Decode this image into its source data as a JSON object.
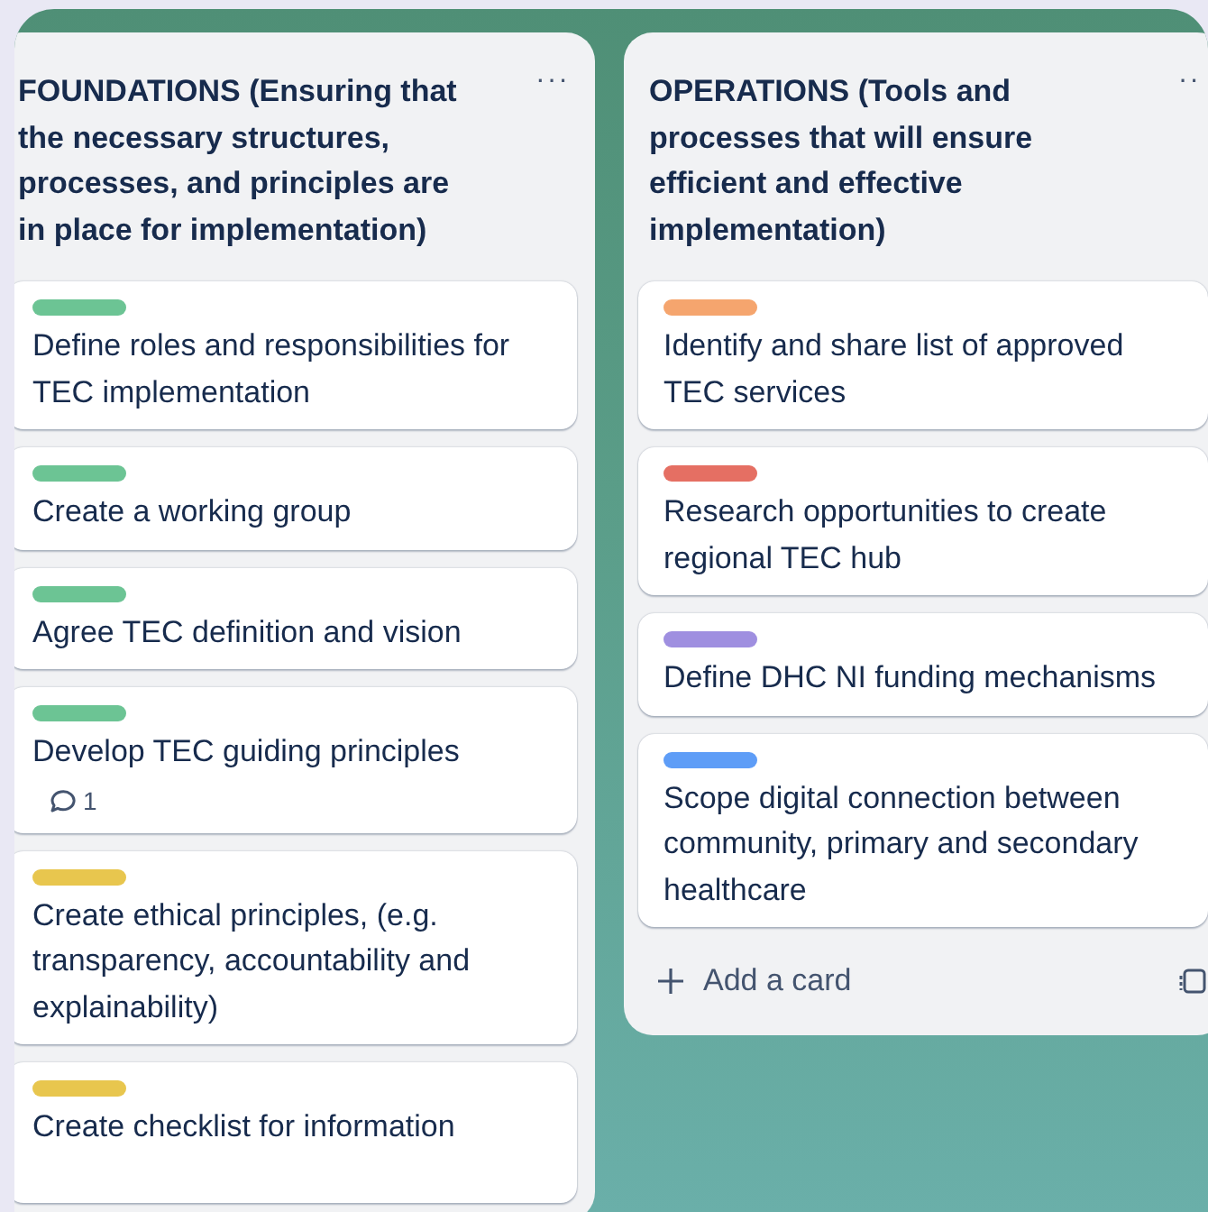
{
  "lists": [
    {
      "title": "FOUNDATIONS (Ensuring that the necessary structures, processes, and principles are in place for implementation)",
      "menu": "···",
      "cards": [
        {
          "color": "#6cc494",
          "text": "Define roles and responsibilities for TEC implementation"
        },
        {
          "color": "#6cc494",
          "text": "Create a working group"
        },
        {
          "color": "#6cc494",
          "text": "Agree TEC definition and vision"
        },
        {
          "color": "#6cc494",
          "text": "Develop TEC guiding principles",
          "comments": "1"
        },
        {
          "color": "#e8c64e",
          "text": "Create ethical principles, (e.g. transparency, accountability and explainability)"
        },
        {
          "color": "#e8c64e",
          "text": "Create checklist for information"
        }
      ]
    },
    {
      "title": "OPERATIONS (Tools and processes that will ensure efficient and effective implementation)",
      "menu": "··",
      "cards": [
        {
          "color": "#f5a56e",
          "text": "Identify and share list of approved TEC services"
        },
        {
          "color": "#e56f63",
          "text": "Research opportunities to create regional TEC hub"
        },
        {
          "color": "#9f8fe0",
          "text": "Define DHC NI funding mechanisms"
        },
        {
          "color": "#5e9df7",
          "text": "Scope digital connection between community, primary and secondary healthcare"
        }
      ],
      "add_card": "Add a card"
    }
  ]
}
